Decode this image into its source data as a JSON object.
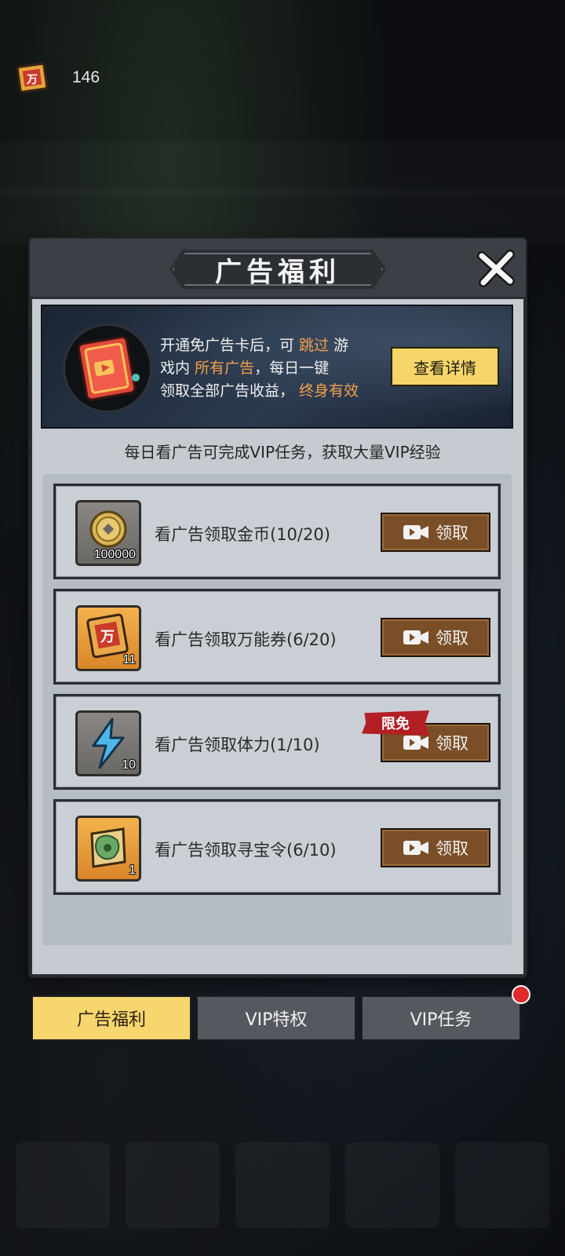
{
  "currency": {
    "value": "146",
    "icon": "coupon-scroll-icon"
  },
  "panel": {
    "title": "广告福利",
    "close_icon": "close-icon"
  },
  "banner": {
    "line1_a": "开通免广告卡后，可 ",
    "line1_hl": "跳过",
    "line1_b": " 游",
    "line2_a": "戏内 ",
    "line2_hl": "所有广告",
    "line2_b": "，每日一键",
    "line3_a": "领取全部广告收益， ",
    "line3_hl": "终身有效",
    "details_button": "查看详情"
  },
  "subtitle": "每日看广告可完成VIP任务，获取大量VIP经验",
  "rows": [
    {
      "label": "看广告领取金币(10/20)",
      "count": "100000",
      "icon": "gold-coin-icon",
      "button": "领取",
      "badge": ""
    },
    {
      "label": "看广告领取万能券(6/20)",
      "count": "11",
      "icon": "universal-coupon-icon",
      "button": "领取",
      "badge": ""
    },
    {
      "label": "看广告领取体力(1/10)",
      "count": "10",
      "icon": "lightning-energy-icon",
      "button": "领取",
      "badge": "限免"
    },
    {
      "label": "看广告领取寻宝令(6/10)",
      "count": "1",
      "icon": "treasure-token-icon",
      "button": "领取",
      "badge": ""
    }
  ],
  "tabs": [
    {
      "label": "广告福利",
      "active": true
    },
    {
      "label": "VIP特权",
      "active": false
    },
    {
      "label": "VIP任务",
      "active": false
    }
  ],
  "colors": {
    "accent_yellow": "#f7d66e",
    "claim_brown": "#7a4e27",
    "highlight_orange": "#f2a04a",
    "badge_red": "#b21f24"
  }
}
